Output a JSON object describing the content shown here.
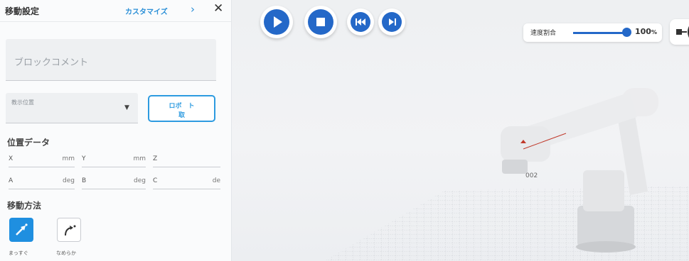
{
  "panel": {
    "title": "移動設定",
    "customize_label": "カスタマイズ",
    "chevron": "›",
    "close": "✕",
    "comment_placeholder": "ブロックコメント",
    "display_position_label": "教示位置",
    "robot_button_label": "ロボ　ト",
    "robot_button_label2": "取",
    "position_data_heading": "位置データ",
    "fields_row1": [
      {
        "name": "X",
        "unit": "mm"
      },
      {
        "name": "Y",
        "unit": "mm"
      },
      {
        "name": "Z",
        "unit": ""
      }
    ],
    "fields_row2": [
      {
        "name": "A",
        "unit": "deg"
      },
      {
        "name": "B",
        "unit": "deg"
      },
      {
        "name": "C",
        "unit": "de"
      }
    ],
    "move_method_heading": "移動方法",
    "move_methods": [
      {
        "label": "まっすぐ",
        "icon": "straight-arrow-icon",
        "active": true
      },
      {
        "label": "なめらか",
        "icon": "curved-arrow-icon",
        "active": false
      }
    ]
  },
  "viewport": {
    "speed_label": "速度割合",
    "speed_value": "100",
    "speed_unit": "%",
    "speed_level_percent": 100,
    "robot_tag": "002",
    "colors": {
      "accent": "#2468c8",
      "button_outline": "#2d9be0"
    }
  }
}
